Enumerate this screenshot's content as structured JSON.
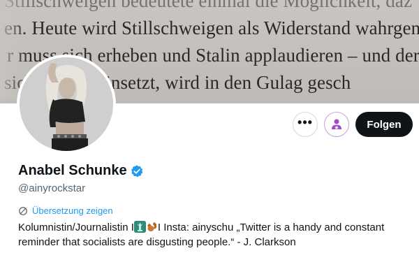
{
  "banner": {
    "line1": "Stillschweigen bedeutete einmal die Möglichkeit, daz",
    "line2": "en. Heute wird Stillschweigen als Widerstand wahrgenom",
    "line3": "r muss sich erheben und Stalin applaudieren – und der",
    "line4": "sich  wieder hinsetzt, wird in den Gulag gesch"
  },
  "actions": {
    "more_label": "•••",
    "follow_label": "Folgen"
  },
  "profile": {
    "name": "Anabel Schunke",
    "handle": "@ainyrockstar",
    "translate_label": "Übersetzung zeigen",
    "bio_part1": "Kolumnistin/Journalistin I",
    "bio_part2": "I Insta: ainyschu „Twitter is a handy and constant reminder that socialists are disgusting people.“ - J. Clarkson"
  },
  "colors": {
    "accent": "#1d9bf0",
    "follow_bg": "#0f1419",
    "subscribe": "#a24ac5",
    "text_secondary": "#536471"
  },
  "icons": {
    "verified": "verified-badge-icon",
    "subscribe": "subscribe-person-star-icon",
    "translate": "translate-globe-icon",
    "emoji1": "statue-of-liberty-emoji",
    "emoji2": "squirrel-emoji"
  }
}
